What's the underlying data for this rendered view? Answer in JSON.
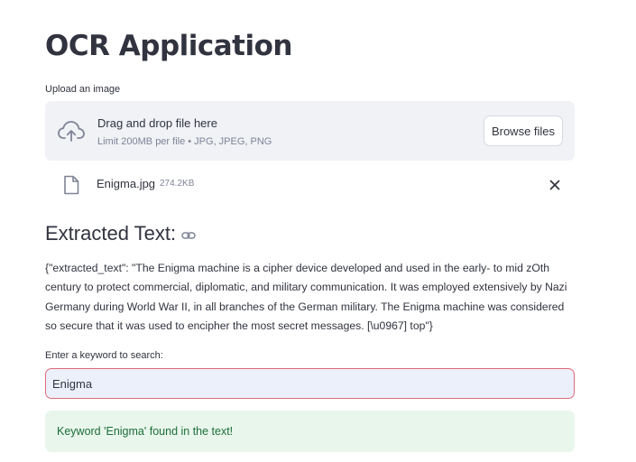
{
  "page": {
    "title": "OCR Application"
  },
  "uploader": {
    "label": "Upload an image",
    "dropzone_title": "Drag and drop file here",
    "dropzone_subtitle": "Limit 200MB per file • JPG, JPEG, PNG",
    "browse_label": "Browse files",
    "icon": "cloud-upload-icon"
  },
  "uploaded_file": {
    "name": "Enigma.jpg",
    "size": "274.2KB",
    "icon": "file-icon",
    "remove_icon": "close-icon"
  },
  "extracted": {
    "heading": "Extracted Text:",
    "anchor_icon": "link-icon",
    "text": "{\"extracted_text\": \"The Enigma machine is a cipher device developed and used in the early- to mid zOth century to protect commercial, diplomatic, and military communication. It was employed extensively by Nazi Germany during World War II, in all branches of the German military. The Enigma machine was considered so secure that it was used to encipher the most secret messages. [\\u0967] top\"}"
  },
  "search": {
    "label": "Enter a keyword to search:",
    "value": "Enigma"
  },
  "result": {
    "message": "Keyword 'Enigma' found in the text!"
  },
  "colors": {
    "text": "#31333f",
    "muted": "#808495",
    "dropzone_bg": "#f0f2f6",
    "input_border": "#e06a77",
    "input_bg": "#ecf0fb",
    "success_bg": "#e9f6ec",
    "success_text": "#1b6e3a"
  }
}
